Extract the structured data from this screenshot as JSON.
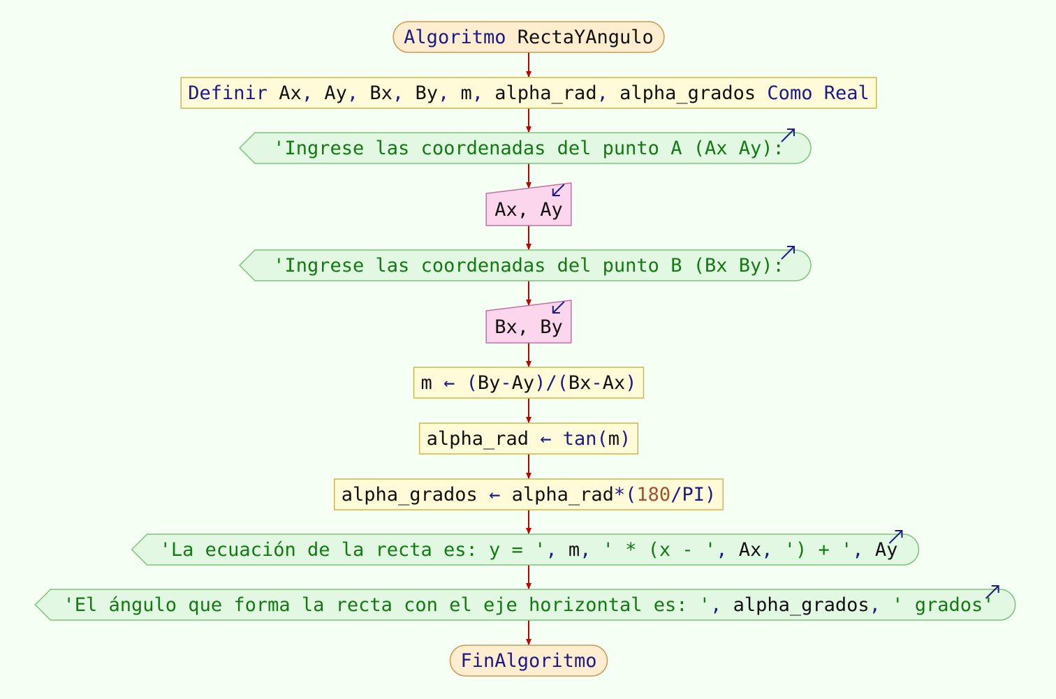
{
  "algorithm": {
    "start": [
      {
        "t": "Algoritmo",
        "c": "kw"
      },
      {
        "t": " RectaYAngulo",
        "c": "id"
      }
    ],
    "end": [
      {
        "t": "FinAlgoritmo",
        "c": "kw"
      }
    ]
  },
  "steps": [
    {
      "kind": "process",
      "name": "define-variables-step",
      "tokens": [
        {
          "t": "Definir",
          "c": "kw"
        },
        {
          "t": " Ax",
          "c": "id"
        },
        {
          "t": ",",
          "c": "kw"
        },
        {
          "t": " Ay",
          "c": "id"
        },
        {
          "t": ",",
          "c": "kw"
        },
        {
          "t": " Bx",
          "c": "id"
        },
        {
          "t": ",",
          "c": "kw"
        },
        {
          "t": " By",
          "c": "id"
        },
        {
          "t": ",",
          "c": "kw"
        },
        {
          "t": " m",
          "c": "id"
        },
        {
          "t": ",",
          "c": "kw"
        },
        {
          "t": " alpha_rad",
          "c": "id"
        },
        {
          "t": ",",
          "c": "kw"
        },
        {
          "t": " alpha_grados",
          "c": "id"
        },
        {
          "t": " Como",
          "c": "kw"
        },
        {
          "t": " Real",
          "c": "kw"
        }
      ]
    },
    {
      "kind": "output",
      "name": "output-prompt-a-step",
      "tokens": [
        {
          "t": "'Ingrese las coordenadas del punto A (Ax Ay): ",
          "c": "str"
        }
      ]
    },
    {
      "kind": "input",
      "name": "input-a-step",
      "tokens": [
        {
          "t": "Ax",
          "c": "id"
        },
        {
          "t": ",",
          "c": "id"
        },
        {
          "t": " Ay",
          "c": "id"
        }
      ]
    },
    {
      "kind": "output",
      "name": "output-prompt-b-step",
      "tokens": [
        {
          "t": "'Ingrese las coordenadas del punto B (Bx By): ",
          "c": "str"
        }
      ]
    },
    {
      "kind": "input",
      "name": "input-b-step",
      "tokens": [
        {
          "t": "Bx",
          "c": "id"
        },
        {
          "t": ",",
          "c": "id"
        },
        {
          "t": " By",
          "c": "id"
        }
      ]
    },
    {
      "kind": "process",
      "name": "assign-slope-step",
      "tokens": [
        {
          "t": "m",
          "c": "id"
        },
        {
          "t": " ←",
          "c": "kw"
        },
        {
          "t": " (",
          "c": "kw"
        },
        {
          "t": "By",
          "c": "id"
        },
        {
          "t": "-",
          "c": "kw"
        },
        {
          "t": "Ay",
          "c": "id"
        },
        {
          "t": ")/(",
          "c": "kw"
        },
        {
          "t": "Bx",
          "c": "id"
        },
        {
          "t": "-",
          "c": "kw"
        },
        {
          "t": "Ax",
          "c": "id"
        },
        {
          "t": ")",
          "c": "kw"
        }
      ]
    },
    {
      "kind": "process",
      "name": "assign-alpha-rad-step",
      "tokens": [
        {
          "t": "alpha_rad",
          "c": "id"
        },
        {
          "t": " ←",
          "c": "kw"
        },
        {
          "t": " tan(",
          "c": "kw"
        },
        {
          "t": "m",
          "c": "id"
        },
        {
          "t": ")",
          "c": "kw"
        }
      ]
    },
    {
      "kind": "process",
      "name": "assign-alpha-grados-step",
      "tokens": [
        {
          "t": "alpha_grados",
          "c": "id"
        },
        {
          "t": " ←",
          "c": "kw"
        },
        {
          "t": " alpha_rad",
          "c": "id"
        },
        {
          "t": "*(",
          "c": "kw"
        },
        {
          "t": "180",
          "c": "num"
        },
        {
          "t": "/PI)",
          "c": "kw"
        }
      ]
    },
    {
      "kind": "output",
      "name": "output-equation-step",
      "tokens": [
        {
          "t": "'La ecuación de la recta es: y = '",
          "c": "str"
        },
        {
          "t": ",",
          "c": "kw"
        },
        {
          "t": " m",
          "c": "id"
        },
        {
          "t": ",",
          "c": "kw"
        },
        {
          "t": " ' * (x - '",
          "c": "str"
        },
        {
          "t": ",",
          "c": "kw"
        },
        {
          "t": " Ax",
          "c": "id"
        },
        {
          "t": ",",
          "c": "kw"
        },
        {
          "t": " ') + '",
          "c": "str"
        },
        {
          "t": ",",
          "c": "kw"
        },
        {
          "t": " Ay",
          "c": "id"
        }
      ]
    },
    {
      "kind": "output",
      "name": "output-angle-step",
      "tokens": [
        {
          "t": "'El ángulo que forma la recta con el eje horizontal es: '",
          "c": "str"
        },
        {
          "t": ",",
          "c": "kw"
        },
        {
          "t": " alpha_grados",
          "c": "id"
        },
        {
          "t": ",",
          "c": "kw"
        },
        {
          "t": " ' grados'",
          "c": "str"
        }
      ]
    }
  ],
  "colors": {
    "background": "#f6fff4",
    "keyword": "#1a1a8c",
    "identifier": "#111111",
    "string": "#117a11",
    "number": "#a0522d",
    "flow_arrow": "#c00000"
  }
}
